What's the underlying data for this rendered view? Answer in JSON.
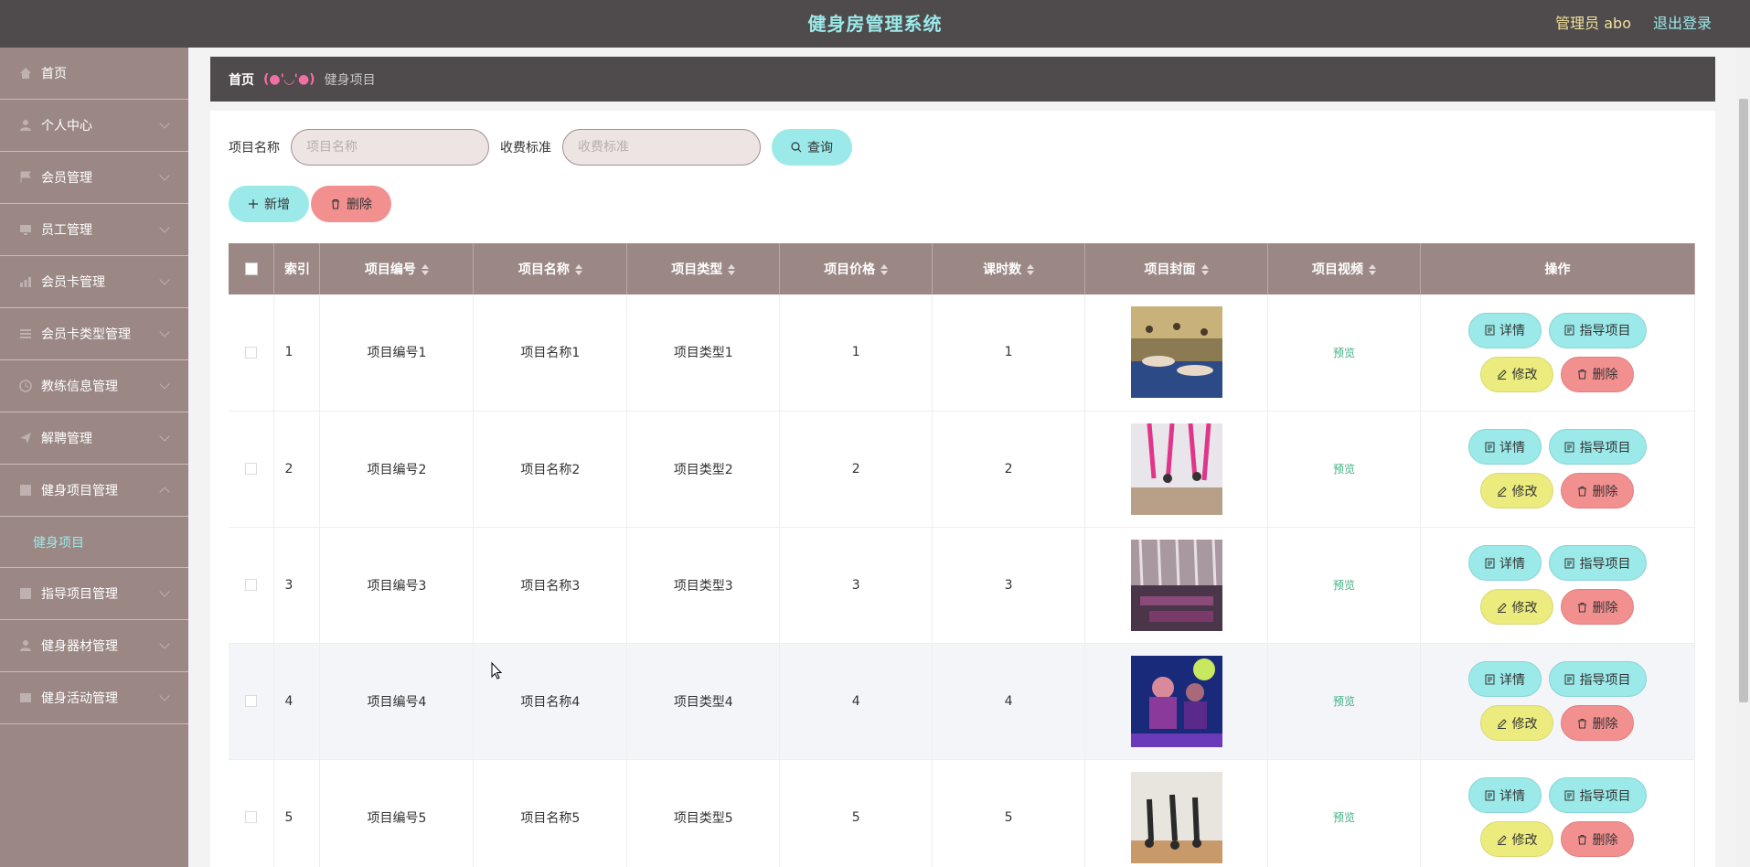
{
  "header": {
    "title": "健身房管理系统",
    "user": "管理员 abo",
    "logout": "退出登录"
  },
  "sidebar": {
    "items": [
      {
        "label": "首页",
        "icon": "home-icon",
        "expandable": false
      },
      {
        "label": "个人中心",
        "icon": "user-icon",
        "expandable": true
      },
      {
        "label": "会员管理",
        "icon": "flag-icon",
        "expandable": true
      },
      {
        "label": "员工管理",
        "icon": "monitor-icon",
        "expandable": true
      },
      {
        "label": "会员卡管理",
        "icon": "chart-icon",
        "expandable": true
      },
      {
        "label": "会员卡类型管理",
        "icon": "list-icon",
        "expandable": true
      },
      {
        "label": "教练信息管理",
        "icon": "clock-icon",
        "expandable": true
      },
      {
        "label": "解聘管理",
        "icon": "send-icon",
        "expandable": true
      },
      {
        "label": "健身项目管理",
        "icon": "grid-icon",
        "expandable": true,
        "open": true
      }
    ],
    "subitem": {
      "label": "健身项目"
    },
    "items_after": [
      {
        "label": "指导项目管理",
        "icon": "grid-icon",
        "expandable": true
      },
      {
        "label": "健身器材管理",
        "icon": "user-icon",
        "expandable": true
      },
      {
        "label": "健身活动管理",
        "icon": "table-icon",
        "expandable": true
      }
    ]
  },
  "breadcrumb": {
    "home": "首页",
    "separator": "(●'◡'●)",
    "current": "健身项目"
  },
  "search": {
    "name_label": "项目名称",
    "name_placeholder": "项目名称",
    "fee_label": "收费标准",
    "fee_placeholder": "收费标准",
    "query_label": "查询"
  },
  "actions": {
    "add_label": "新增",
    "delete_label": "删除"
  },
  "table": {
    "headers": [
      "索引",
      "项目编号",
      "项目名称",
      "项目类型",
      "项目价格",
      "课时数",
      "项目封面",
      "项目视频",
      "操作"
    ],
    "rows": [
      {
        "index": "1",
        "code": "项目编号1",
        "name": "项目名称1",
        "type": "项目类型1",
        "price": "1",
        "hours": "1",
        "video": "预览"
      },
      {
        "index": "2",
        "code": "项目编号2",
        "name": "项目名称2",
        "type": "项目类型2",
        "price": "2",
        "hours": "2",
        "video": "预览"
      },
      {
        "index": "3",
        "code": "项目编号3",
        "name": "项目名称3",
        "type": "项目类型3",
        "price": "3",
        "hours": "3",
        "video": "预览"
      },
      {
        "index": "4",
        "code": "项目编号4",
        "name": "项目名称4",
        "type": "项目类型4",
        "price": "4",
        "hours": "4",
        "video": "预览"
      },
      {
        "index": "5",
        "code": "项目编号5",
        "name": "项目名称5",
        "type": "项目类型5",
        "price": "5",
        "hours": "5",
        "video": "预览"
      }
    ],
    "ops": {
      "detail": "详情",
      "guide": "指导项目",
      "edit": "修改",
      "delete": "删除"
    }
  },
  "colors": {
    "header_bg": "#4f4a4c",
    "sidebar_bg": "#9b8885",
    "accent_cyan": "#9be9e9",
    "accent_yellow": "#ecec7e",
    "accent_red": "#f29090"
  }
}
